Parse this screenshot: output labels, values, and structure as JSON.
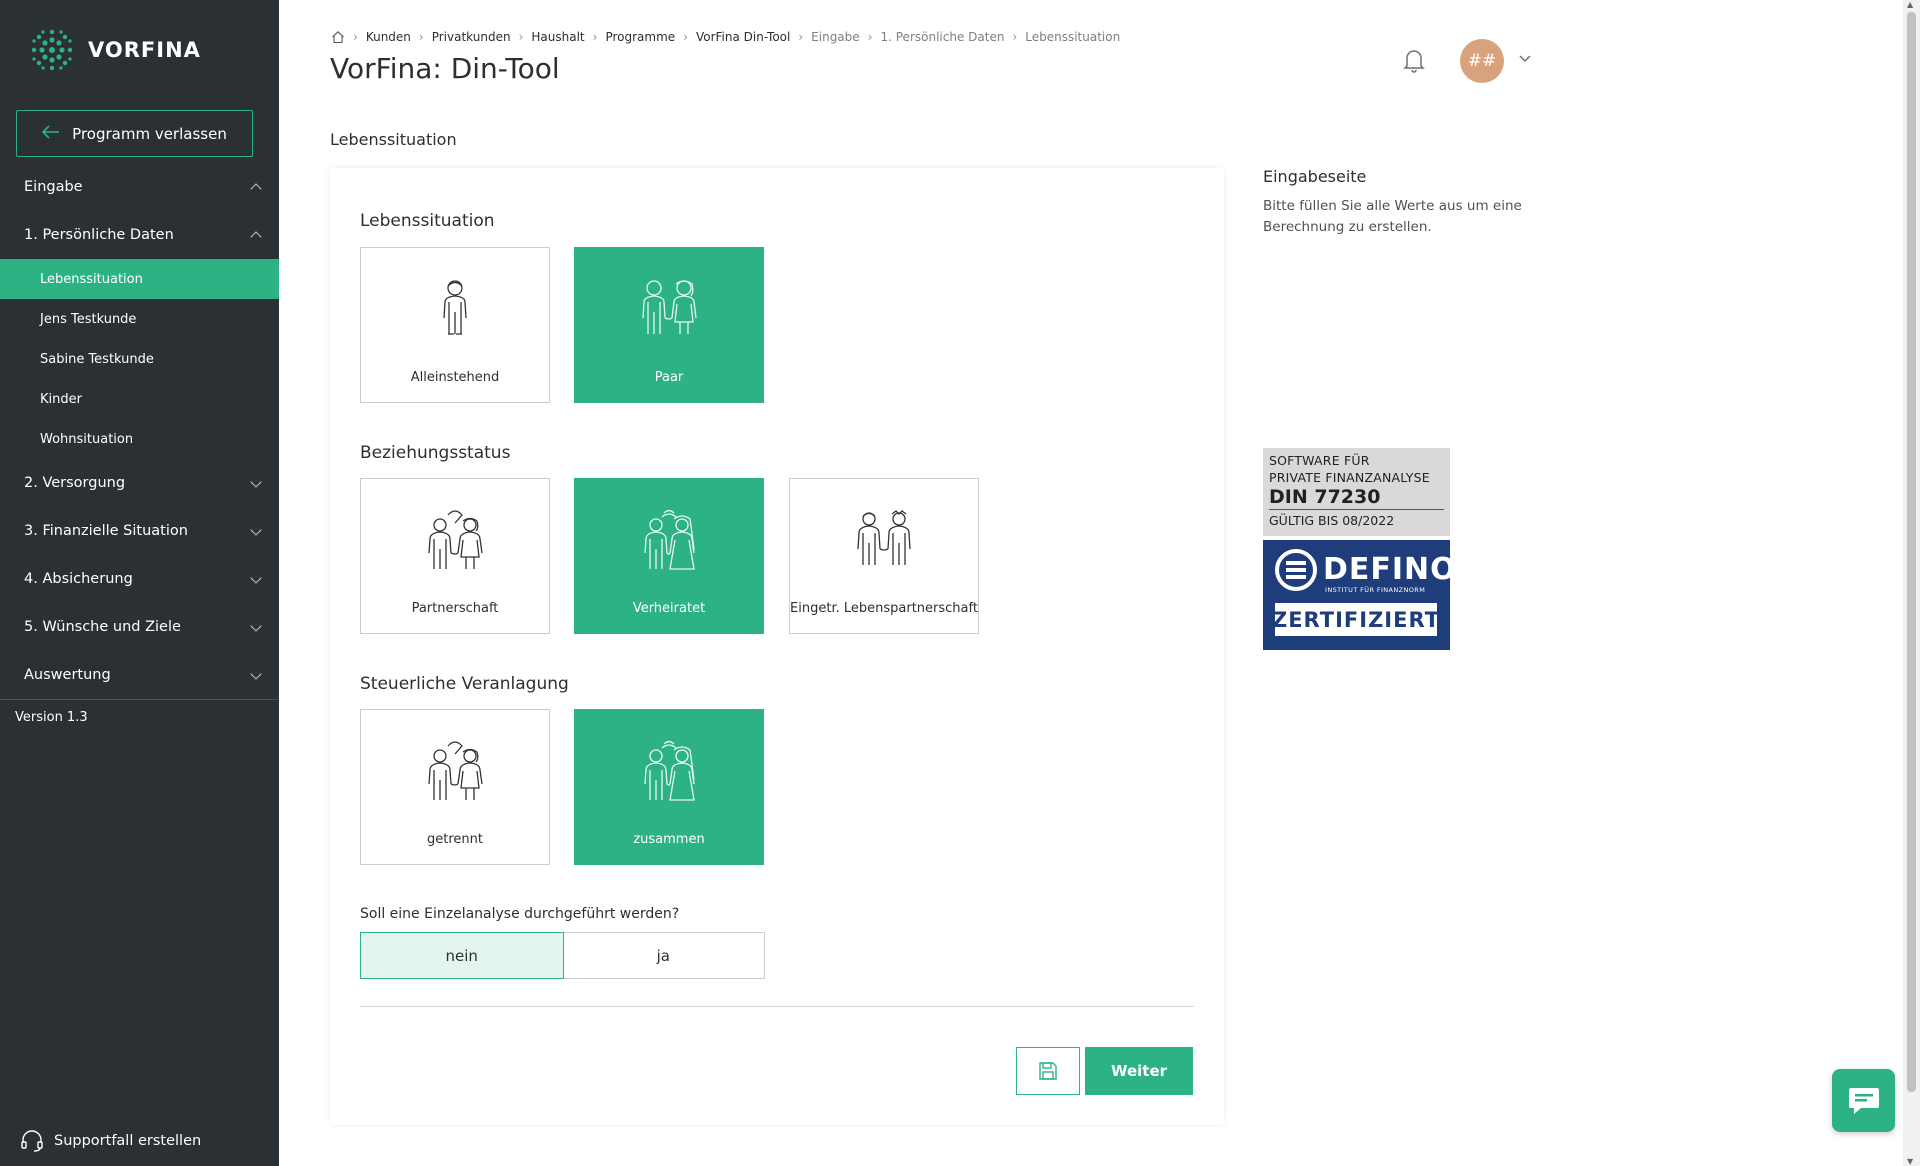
{
  "sidebar": {
    "brand": "VORFINA",
    "exit_label": "Programm verlassen",
    "nav": {
      "eingabe": "Eingabe",
      "personal": "1. Persönliche Daten",
      "sub": [
        "Lebenssituation",
        "Jens Testkunde",
        "Sabine Testkunde",
        "Kinder",
        "Wohnsituation"
      ],
      "versorgung": "2. Versorgung",
      "finanzielle": "3. Finanzielle Situation",
      "absicherung": "4. Absicherung",
      "wuensche": "5. Wünsche und Ziele",
      "auswertung": "Auswertung"
    },
    "version": "Version 1.3",
    "support": "Supportfall erstellen"
  },
  "header": {
    "breadcrumb": [
      "Kunden",
      "Privatkunden",
      "Haushalt",
      "Programme",
      "VorFina Din-Tool",
      "Eingabe",
      "1. Persönliche Daten",
      "Lebenssituation"
    ],
    "title": "VorFina: Din-Tool",
    "avatar_initials": "##"
  },
  "section_label": "Lebenssituation",
  "form": {
    "lebenssituation": {
      "title": "Lebenssituation",
      "options": [
        "Alleinstehend",
        "Paar"
      ],
      "selected": "Paar"
    },
    "beziehungsstatus": {
      "title": "Beziehungsstatus",
      "options": [
        "Partnerschaft",
        "Verheiratet",
        "Eingetr. Lebenspartnerschaft"
      ],
      "selected": "Verheiratet"
    },
    "veranlagung": {
      "title": "Steuerliche Veranlagung",
      "options": [
        "getrennt",
        "zusammen"
      ],
      "selected": "zusammen"
    },
    "einzelanalyse": {
      "question": "Soll eine Einzelanalyse durchgeführt werden?",
      "options": [
        "nein",
        "ja"
      ],
      "selected": "nein"
    },
    "next_label": "Weiter"
  },
  "info": {
    "title": "Eingabeseite",
    "text": "Bitte füllen Sie alle Werte aus um eine Berechnung zu erstellen."
  },
  "badge": {
    "line1": "SOFTWARE FÜR",
    "line2": "PRIVATE FINANZANALYSE",
    "din": "DIN 77230",
    "valid": "GÜLTIG BIS 08/2022",
    "brand": "DEFINO",
    "brand_sub": "INSTITUT FÜR FINANZNORM",
    "cert": "ZERTIFIZIERT"
  },
  "colors": {
    "accent": "#2db383",
    "sidebar_bg": "#2b3035",
    "badge_blue": "#1f3d7a"
  }
}
